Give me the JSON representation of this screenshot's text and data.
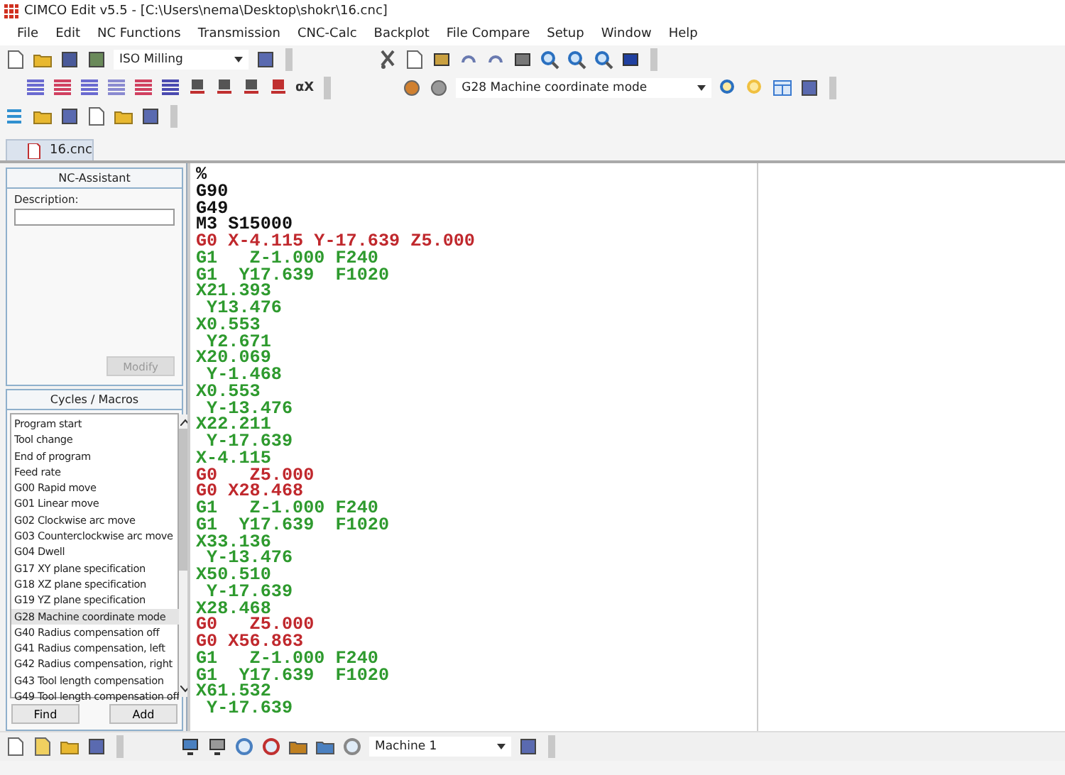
{
  "window": {
    "title": "CIMCO Edit v5.5 - [C:\\Users\\nema\\Desktop\\shokr\\16.cnc]"
  },
  "menu": [
    "File",
    "Edit",
    "NC Functions",
    "Transmission",
    "CNC-Calc",
    "Backplot",
    "File Compare",
    "Setup",
    "Window",
    "Help"
  ],
  "toolbar": {
    "machine_type": "ISO Milling",
    "alpha_button": "αX",
    "macro_select": "G28 Machine coordinate mode"
  },
  "tabs": [
    {
      "label": "16.cnc",
      "selected": true
    }
  ],
  "nc_assistant": {
    "title": "NC-Assistant",
    "description_label": "Description:",
    "modify_button": "Modify",
    "modify_disabled": true
  },
  "cycles": {
    "title": "Cycles / Macros",
    "items": [
      {
        "label": "Program start",
        "selected": false
      },
      {
        "label": "Tool change",
        "selected": false
      },
      {
        "label": "End of program",
        "selected": false
      },
      {
        "label": "Feed rate",
        "selected": false
      },
      {
        "label": "G00 Rapid move",
        "selected": false
      },
      {
        "label": "G01 Linear move",
        "selected": false
      },
      {
        "label": "G02 Clockwise arc move",
        "selected": false
      },
      {
        "label": "G03 Counterclockwise arc move",
        "selected": false
      },
      {
        "label": "G04 Dwell",
        "selected": false
      },
      {
        "label": "G17 XY plane specification",
        "selected": false
      },
      {
        "label": "G18 XZ plane specification",
        "selected": false
      },
      {
        "label": "G19 YZ plane specification",
        "selected": false
      },
      {
        "label": "G28 Machine coordinate mode",
        "selected": true
      },
      {
        "label": "G40 Radius compensation off",
        "selected": false
      },
      {
        "label": "G41 Radius compensation, left",
        "selected": false
      },
      {
        "label": "G42 Radius compensation, right",
        "selected": false
      },
      {
        "label": "G43 Tool length compensation",
        "selected": false
      },
      {
        "label": "G49 Tool length compensation off",
        "selected": false
      }
    ],
    "buttons": [
      "Find",
      "Add"
    ]
  },
  "code_lines": [
    {
      "text": "%",
      "kind": "plain"
    },
    {
      "text": "G90",
      "kind": "plain"
    },
    {
      "text": "G49",
      "kind": "plain"
    },
    {
      "text": "M3 S15000",
      "kind": "plain"
    },
    {
      "text": "G0 X-4.115 Y-17.639 Z5.000",
      "kind": "rapid"
    },
    {
      "text": "G1   Z-1.000 F240",
      "kind": "feed"
    },
    {
      "text": "G1  Y17.639  F1020",
      "kind": "feed"
    },
    {
      "text": "X21.393",
      "kind": "feed"
    },
    {
      "text": " Y13.476",
      "kind": "feed"
    },
    {
      "text": "X0.553",
      "kind": "feed"
    },
    {
      "text": " Y2.671",
      "kind": "feed"
    },
    {
      "text": "X20.069",
      "kind": "feed"
    },
    {
      "text": " Y-1.468",
      "kind": "feed"
    },
    {
      "text": "X0.553",
      "kind": "feed"
    },
    {
      "text": " Y-13.476",
      "kind": "feed"
    },
    {
      "text": "X22.211",
      "kind": "feed"
    },
    {
      "text": " Y-17.639",
      "kind": "feed"
    },
    {
      "text": "X-4.115",
      "kind": "feed"
    },
    {
      "text": "G0   Z5.000",
      "kind": "rapid"
    },
    {
      "text": "G0 X28.468",
      "kind": "rapid"
    },
    {
      "text": "G1   Z-1.000 F240",
      "kind": "feed"
    },
    {
      "text": "G1  Y17.639  F1020",
      "kind": "feed"
    },
    {
      "text": "X33.136",
      "kind": "feed"
    },
    {
      "text": " Y-13.476",
      "kind": "feed"
    },
    {
      "text": "X50.510",
      "kind": "feed"
    },
    {
      "text": " Y-17.639",
      "kind": "feed"
    },
    {
      "text": "X28.468",
      "kind": "feed"
    },
    {
      "text": "G0   Z5.000",
      "kind": "rapid"
    },
    {
      "text": "G0 X56.863",
      "kind": "rapid"
    },
    {
      "text": "G1   Z-1.000 F240",
      "kind": "feed"
    },
    {
      "text": "G1  Y17.639  F1020",
      "kind": "feed"
    },
    {
      "text": "X61.532",
      "kind": "feed"
    },
    {
      "text": " Y-17.639",
      "kind": "feed"
    }
  ],
  "bottom_toolbar": {
    "machine": "Machine 1"
  }
}
